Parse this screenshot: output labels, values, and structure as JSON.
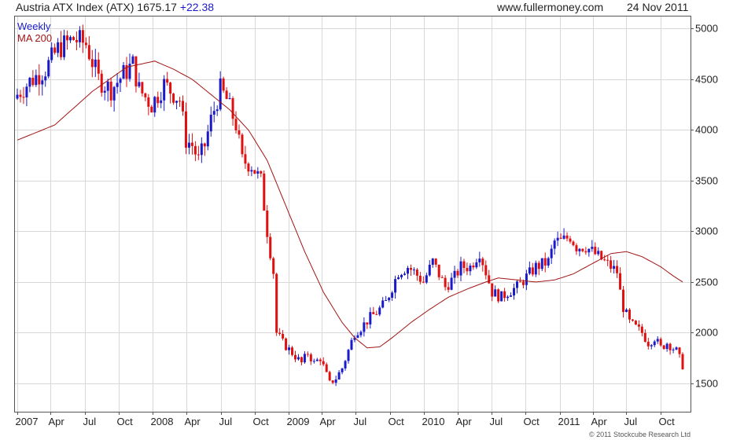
{
  "header": {
    "title": "Austria ATX Index (ATX) 1675.17",
    "change": "+22.38",
    "site": "www.fullermoney.com",
    "date": "24 Nov 2011"
  },
  "copyright": "© 2011 Stockcube Research Ltd",
  "chart_data": {
    "type": "candlestick",
    "title": "Austria ATX Index (ATX) 1675.17 +22.38",
    "ylim": [
      1220,
      5120
    ],
    "y_ticks": [
      1500,
      2000,
      2500,
      3000,
      3500,
      4000,
      4500,
      5000
    ],
    "x_ticks": [
      "2007",
      "Apr",
      "Jul",
      "Oct",
      "2008",
      "Apr",
      "Jul",
      "Oct",
      "2009",
      "Apr",
      "Jul",
      "Oct",
      "2010",
      "Apr",
      "Jul",
      "Oct",
      "2011",
      "Apr",
      "Jul",
      "Oct"
    ],
    "legend": [
      {
        "label": "Weekly",
        "color": "#1a1ac8"
      },
      {
        "label": "MA 200",
        "color": "#a31515"
      }
    ],
    "up_color": "#1a1ac8",
    "down_color": "#e01010",
    "ma_color": "#a31515",
    "grid": true,
    "weekly_close_anchors": [
      [
        0,
        4350
      ],
      [
        4,
        4480
      ],
      [
        9,
        4600
      ],
      [
        13,
        4800
      ],
      [
        18,
        4900
      ],
      [
        22,
        4850
      ],
      [
        26,
        4500
      ],
      [
        30,
        4400
      ],
      [
        34,
        4550
      ],
      [
        37,
        4650
      ],
      [
        39,
        4400
      ],
      [
        43,
        4250
      ],
      [
        47,
        4450
      ],
      [
        52,
        4300
      ],
      [
        54,
        3900
      ],
      [
        56,
        3850
      ],
      [
        58,
        3700
      ],
      [
        60,
        3850
      ],
      [
        62,
        4100
      ],
      [
        65,
        4400
      ],
      [
        67,
        4300
      ],
      [
        70,
        4050
      ],
      [
        72,
        3700
      ],
      [
        75,
        3650
      ],
      [
        77,
        3550
      ],
      [
        78,
        3500
      ],
      [
        80,
        3000
      ],
      [
        82,
        2600
      ],
      [
        83,
        2000
      ],
      [
        85,
        1900
      ],
      [
        88,
        1800
      ],
      [
        91,
        1700
      ],
      [
        93,
        1800
      ],
      [
        95,
        1700
      ],
      [
        97,
        1750
      ],
      [
        100,
        1500
      ],
      [
        102,
        1550
      ],
      [
        104,
        1650
      ],
      [
        108,
        2000
      ],
      [
        110,
        2050
      ],
      [
        113,
        2150
      ],
      [
        115,
        2200
      ],
      [
        118,
        2300
      ],
      [
        122,
        2600
      ],
      [
        125,
        2650
      ],
      [
        127,
        2600
      ],
      [
        130,
        2500
      ],
      [
        133,
        2700
      ],
      [
        137,
        2450
      ],
      [
        140,
        2550
      ],
      [
        142,
        2650
      ],
      [
        145,
        2650
      ],
      [
        148,
        2800
      ],
      [
        150,
        2600
      ],
      [
        152,
        2400
      ],
      [
        155,
        2350
      ],
      [
        157,
        2400
      ],
      [
        160,
        2450
      ],
      [
        163,
        2550
      ],
      [
        166,
        2650
      ],
      [
        170,
        2700
      ],
      [
        172,
        2900
      ],
      [
        174,
        2900
      ],
      [
        177,
        2950
      ],
      [
        179,
        2850
      ],
      [
        182,
        2850
      ],
      [
        184,
        2800
      ],
      [
        186,
        2750
      ],
      [
        188,
        2700
      ],
      [
        190,
        2650
      ],
      [
        192,
        2600
      ],
      [
        193,
        2400
      ],
      [
        194,
        2250
      ],
      [
        196,
        2100
      ],
      [
        198,
        2050
      ],
      [
        200,
        2000
      ],
      [
        202,
        1900
      ],
      [
        204,
        1950
      ],
      [
        206,
        1850
      ],
      [
        208,
        1900
      ],
      [
        211,
        1820
      ],
      [
        213,
        1675
      ]
    ],
    "ma200_anchors": [
      [
        0,
        3900
      ],
      [
        12,
        4050
      ],
      [
        24,
        4380
      ],
      [
        35,
        4620
      ],
      [
        44,
        4680
      ],
      [
        50,
        4600
      ],
      [
        56,
        4500
      ],
      [
        62,
        4350
      ],
      [
        68,
        4200
      ],
      [
        74,
        4000
      ],
      [
        80,
        3700
      ],
      [
        86,
        3250
      ],
      [
        92,
        2800
      ],
      [
        98,
        2400
      ],
      [
        104,
        2100
      ],
      [
        108,
        1950
      ],
      [
        112,
        1850
      ],
      [
        116,
        1860
      ],
      [
        120,
        1950
      ],
      [
        126,
        2100
      ],
      [
        132,
        2230
      ],
      [
        138,
        2350
      ],
      [
        144,
        2430
      ],
      [
        150,
        2500
      ],
      [
        154,
        2540
      ],
      [
        160,
        2520
      ],
      [
        166,
        2500
      ],
      [
        172,
        2520
      ],
      [
        178,
        2580
      ],
      [
        184,
        2680
      ],
      [
        190,
        2780
      ],
      [
        195,
        2800
      ],
      [
        200,
        2750
      ],
      [
        206,
        2650
      ],
      [
        210,
        2560
      ],
      [
        213,
        2500
      ]
    ],
    "weeks": 214
  }
}
